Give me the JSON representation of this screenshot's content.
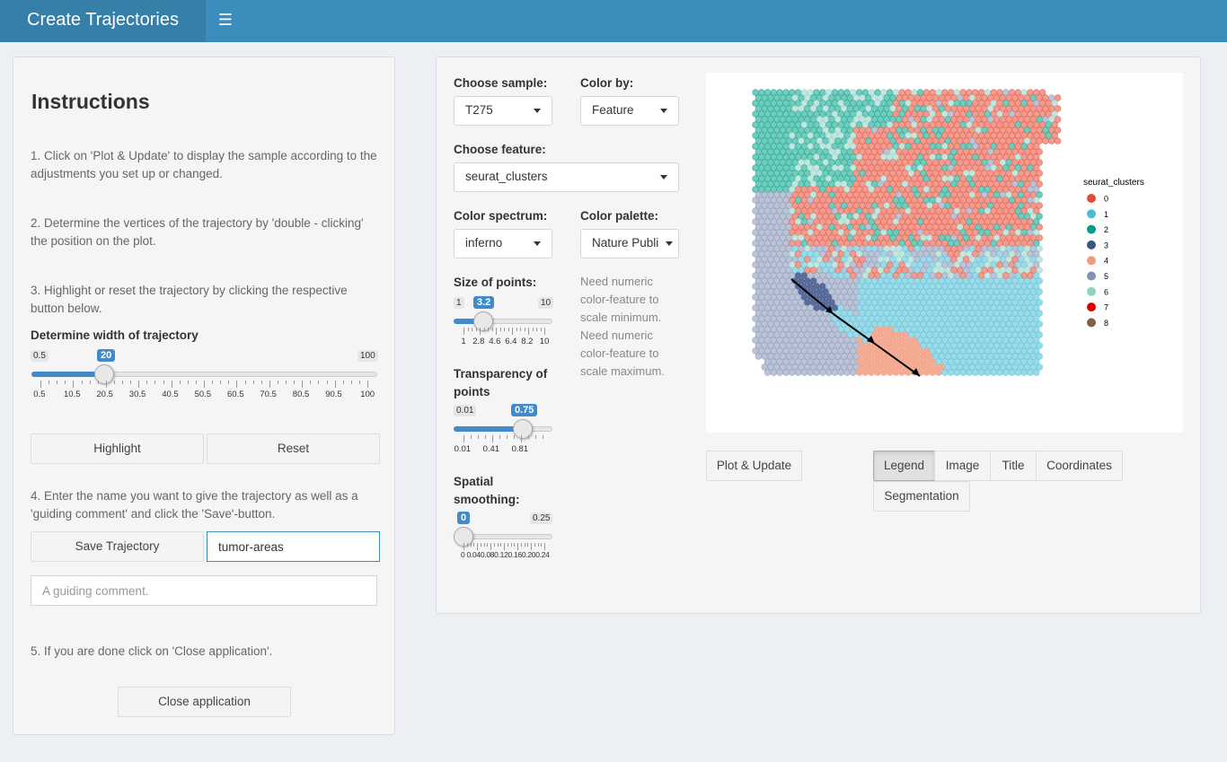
{
  "header": {
    "title": "Create Trajectories",
    "menu_icon": "hamburger-icon"
  },
  "instructions": {
    "title": "Instructions",
    "step1": "1. Click on 'Plot & Update' to display the sample according to the adjustments you set up or changed.",
    "step2": "2. Determine the vertices of the trajectory by 'double - clicking' the position on the plot.",
    "step3": "3. Highlight or reset the trajectory by clicking the respective button below.",
    "width_label": "Determine width of trajectory",
    "width_slider": {
      "min": "0.5",
      "max": "100",
      "value": "20",
      "fraction": 0.196,
      "ticks": [
        "0.5",
        "10.5",
        "20.5",
        "30.5",
        "40.5",
        "50.5",
        "60.5",
        "70.5",
        "80.5",
        "90.5",
        "100"
      ]
    },
    "highlight_button": "Highlight",
    "reset_button": "Reset",
    "step4": "4. Enter the name you want to give the trajectory as well as a 'guiding comment' and click the 'Save'-button.",
    "save_button": "Save Trajectory",
    "name_value": "tumor-areas",
    "comment_placeholder": "A guiding comment.",
    "step5": "5. If you are done click on 'Close application'.",
    "close_button": "Close application"
  },
  "controls": {
    "sample_label": "Choose sample:",
    "sample_value": "T275",
    "colorby_label": "Color by:",
    "colorby_value": "Feature",
    "feature_label": "Choose feature:",
    "feature_value": "seurat_clusters",
    "spectrum_label": "Color spectrum:",
    "spectrum_value": "inferno",
    "palette_label": "Color palette:",
    "palette_value": "Nature Publi",
    "size_label": "Size of points:",
    "size_slider": {
      "min": "1",
      "max": "10",
      "value": "3.2",
      "fraction": 0.244,
      "ticks": [
        "1",
        "2.8",
        "4.6",
        "6.4",
        "8.2",
        "10"
      ]
    },
    "transparency_label": "Transparency of points",
    "transparency_slider": {
      "min": "0.01",
      "max": "1",
      "value": "0.75",
      "fraction": 0.747,
      "ticks": [
        "0.01",
        "0.41",
        "0.81"
      ]
    },
    "smoothing_label": "Spatial smoothing:",
    "smoothing_slider": {
      "min": "0",
      "max": "0.25",
      "value": "0",
      "fraction": 0,
      "tick_text": "0 0.040.080.120.160.200.24"
    },
    "note": "Need numeric color-feature to scale minimum. Need numeric color-feature to scale maximum."
  },
  "plot_buttons": {
    "plot_update": "Plot & Update",
    "legend": "Legend",
    "image": "Image",
    "title": "Title",
    "coordinates": "Coordinates",
    "segmentation": "Segmentation"
  },
  "legend": {
    "title": "seurat_clusters",
    "items": [
      {
        "label": "0",
        "color": "#e64b35"
      },
      {
        "label": "1",
        "color": "#4dbbd5"
      },
      {
        "label": "2",
        "color": "#00a087"
      },
      {
        "label": "3",
        "color": "#3c5488"
      },
      {
        "label": "4",
        "color": "#f39b7f"
      },
      {
        "label": "5",
        "color": "#8491b4"
      },
      {
        "label": "6",
        "color": "#91d1c2"
      },
      {
        "label": "7",
        "color": "#dc0000"
      },
      {
        "label": "8",
        "color": "#7e6148"
      }
    ]
  }
}
